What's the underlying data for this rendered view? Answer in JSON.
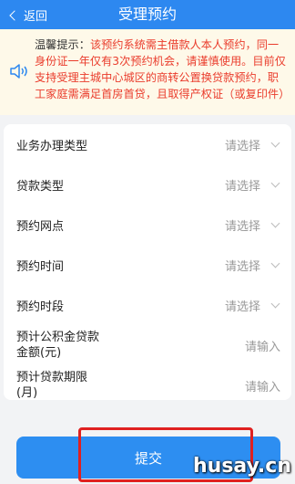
{
  "header": {
    "back_label": "返回",
    "title": "受理预约"
  },
  "notice": {
    "label": "温馨提示：",
    "text": "该预约系统需主借款人本人预约，同一身份证一年仅有3次预约机会，请谨慎使用。目前仅支持受理主城中心城区的商转公置换贷款预约，职工家庭需满足首房首贷，且取得产权证（或复印件）"
  },
  "form": {
    "rows": [
      {
        "label": "业务办理类型",
        "value": "请选择"
      },
      {
        "label": "贷款类型",
        "value": "请选择"
      },
      {
        "label": "预约网点",
        "value": "请选择"
      },
      {
        "label": "预约时间",
        "value": "请选择"
      },
      {
        "label": "预约时段",
        "value": "请选择"
      },
      {
        "label": "预计公积金贷款金额(元)",
        "value": "请输入"
      },
      {
        "label": "预计贷款期限(月)",
        "value": "请输入"
      }
    ]
  },
  "submit_label": "提交",
  "watermark": "husay.cn",
  "colors": {
    "primary": "#2d88f0",
    "notice_bg": "#fef9e9",
    "notice_text": "#ea3c2c",
    "highlight": "#e02020"
  }
}
